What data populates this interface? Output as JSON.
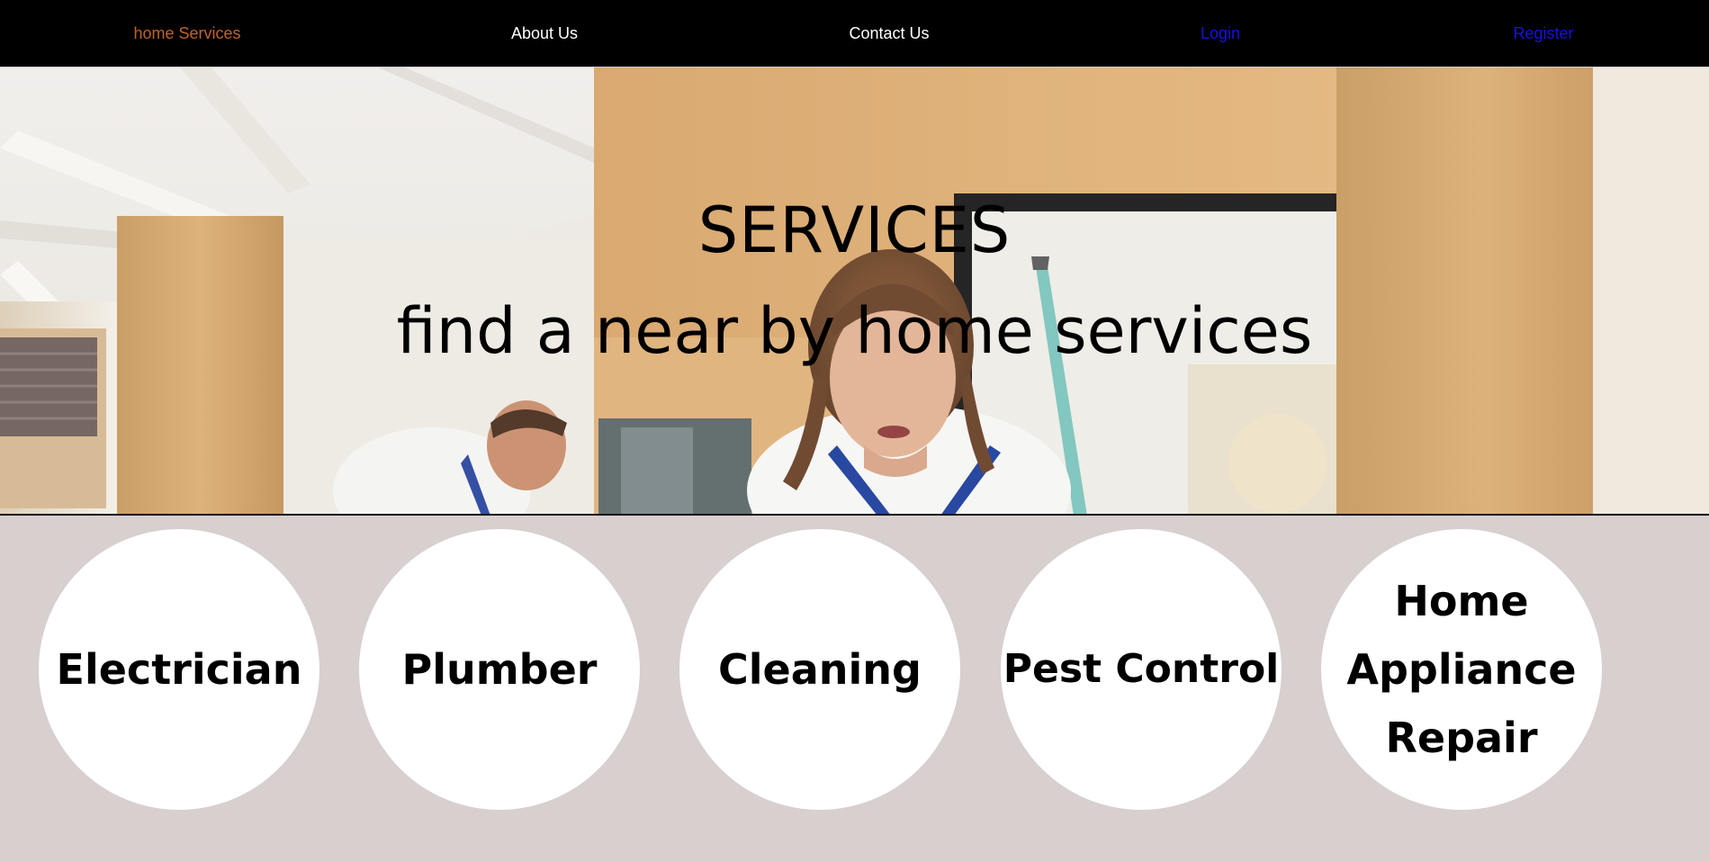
{
  "nav": {
    "items": [
      {
        "label": "home Services",
        "color": "#c0632a"
      },
      {
        "label": "About Us",
        "color": "#ffffff"
      },
      {
        "label": "Contact Us",
        "color": "#ffffff"
      },
      {
        "label": "Login",
        "color": "#1a10e0"
      },
      {
        "label": "Register",
        "color": "#1a10e0"
      }
    ]
  },
  "hero": {
    "title": "SERVICES",
    "subtitle": "find a near by home services"
  },
  "services": {
    "items": [
      {
        "label": "Electrician"
      },
      {
        "label": "Plumber"
      },
      {
        "label": "Cleaning"
      },
      {
        "label": "Pest Control"
      },
      {
        "label": "Home Appliance Repair"
      }
    ]
  }
}
